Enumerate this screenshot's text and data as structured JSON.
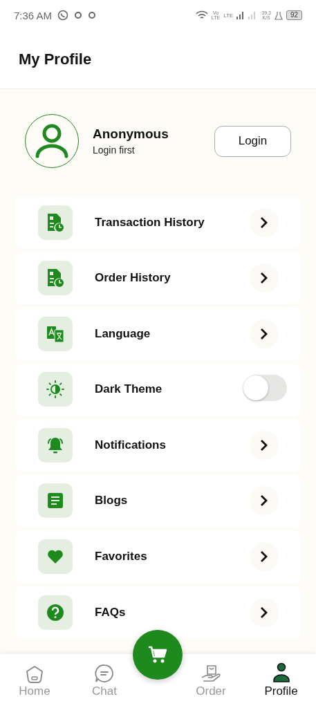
{
  "status_bar": {
    "time": "7:36 AM",
    "volte": [
      "Vo",
      "LTE"
    ],
    "lte": "LTE",
    "speed": [
      "39.3",
      "K/S"
    ],
    "battery": "92"
  },
  "header": {
    "title": "My Profile"
  },
  "profile": {
    "name": "Anonymous",
    "subtitle": "Login first",
    "button": "Login"
  },
  "menu": [
    {
      "label": "Transaction History",
      "kind": "link"
    },
    {
      "label": "Order History",
      "kind": "link"
    },
    {
      "label": "Language",
      "kind": "link"
    },
    {
      "label": "Dark Theme",
      "kind": "toggle",
      "on": false
    },
    {
      "label": "Notifications",
      "kind": "link"
    },
    {
      "label": "Blogs",
      "kind": "link"
    },
    {
      "label": "Favorites",
      "kind": "link"
    },
    {
      "label": "FAQs",
      "kind": "link"
    }
  ],
  "bottom_nav": [
    {
      "label": "Home",
      "selected": false
    },
    {
      "label": "Chat",
      "selected": false
    },
    {
      "label": "Order",
      "selected": false
    },
    {
      "label": "Profile",
      "selected": true
    }
  ]
}
